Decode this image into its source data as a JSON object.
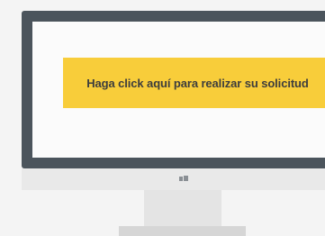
{
  "cta": {
    "label": "Haga click aquí para realizar su solicitud"
  },
  "colors": {
    "cta_background": "#f8cd3a",
    "bezel": "#4b545c",
    "screen": "#fbfbfb"
  },
  "icons": {
    "monitor_logo": "monitor-logo-icon"
  }
}
